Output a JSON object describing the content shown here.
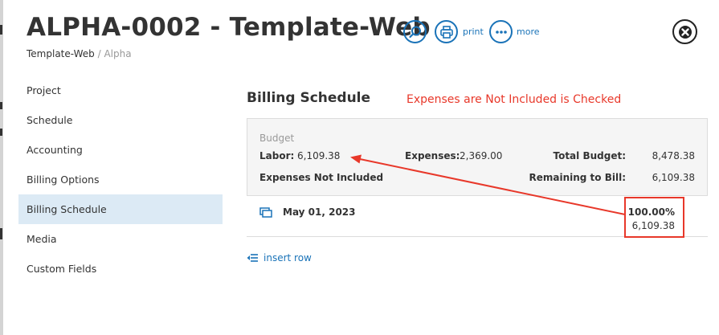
{
  "header": {
    "title": "ALPHA-0002 - Template-Web",
    "breadcrumb": {
      "main": "Template-Web",
      "separator": " / ",
      "sub": "Alpha"
    },
    "actions": {
      "search_icon": "magnifier-icon",
      "print_label": "print",
      "more_label": "more"
    }
  },
  "nav": {
    "items": [
      {
        "label": "Project"
      },
      {
        "label": "Schedule"
      },
      {
        "label": "Accounting"
      },
      {
        "label": "Billing Options"
      },
      {
        "label": "Billing Schedule",
        "active": true
      },
      {
        "label": "Media"
      },
      {
        "label": "Custom Fields"
      }
    ]
  },
  "main": {
    "section_title": "Billing Schedule",
    "annotation": "Expenses are Not Included is Checked",
    "budget": {
      "heading": "Budget",
      "labor_label": "Labor:",
      "labor_value": "6,109.38",
      "expenses_label": "Expenses:",
      "expenses_value": "2,369.00",
      "total_label": "Total Budget:",
      "total_value": "8,478.38",
      "expenses_not_included": "Expenses Not Included",
      "remaining_label": "Remaining to Bill:",
      "remaining_value": "6,109.38"
    },
    "schedule_row": {
      "date": "May 01, 2023",
      "percent": "100.00%",
      "amount": "6,109.38"
    },
    "insert_row_label": "insert row"
  },
  "colors": {
    "accent": "#1a73b8",
    "annotation": "#e8382a",
    "active_nav": "#dceaf5"
  }
}
